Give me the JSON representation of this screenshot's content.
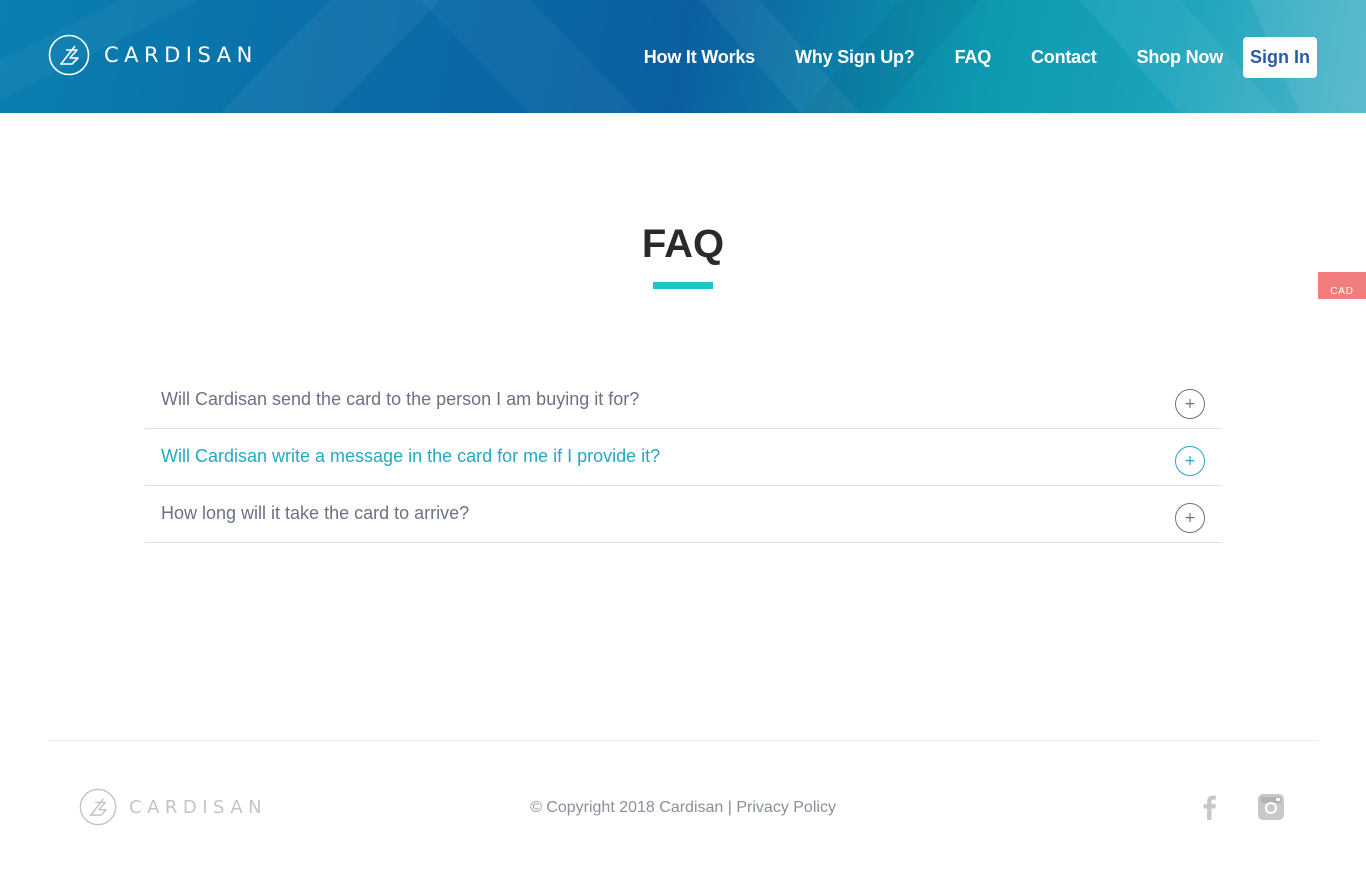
{
  "brand": {
    "name": "CARDISAN"
  },
  "nav": {
    "links": [
      "How It Works",
      "Why Sign Up?",
      "FAQ",
      "Contact",
      "Shop Now"
    ],
    "signin_label": "Sign In"
  },
  "currency": {
    "label": "CAD"
  },
  "page": {
    "title": "FAQ"
  },
  "faq": {
    "items": [
      {
        "question": "Will Cardisan send the card to the person I am buying it for?",
        "toggle": "+",
        "active": false
      },
      {
        "question": "Will Cardisan write a message in the card for me if I provide it?",
        "toggle": "+",
        "active": true
      },
      {
        "question": "How long will it take the card to arrive?",
        "toggle": "+",
        "active": false
      }
    ]
  },
  "footer": {
    "brand": "CARDISAN",
    "copyright": "© Copyright 2018 Cardisan",
    "separator": "|",
    "privacy_label": "Privacy Policy",
    "social": [
      "facebook-icon",
      "instagram-icon"
    ]
  },
  "colors": {
    "accent": "#1ec6cc",
    "active_question": "#24a8c4",
    "signin_text": "#2a5ba8",
    "currency_tab": "#f27d7d"
  }
}
